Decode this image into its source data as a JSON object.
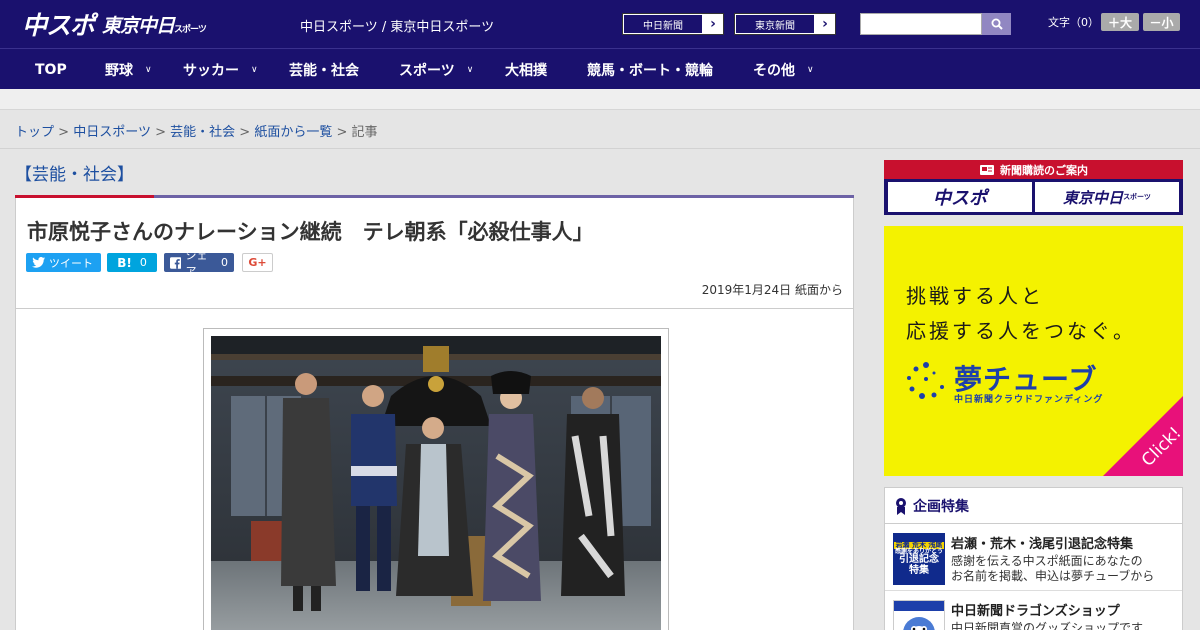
{
  "header": {
    "logo_main": "中スポ",
    "logo_sub": "東京中日",
    "logo_sub_small": "スポーツ",
    "site_title": "中日スポーツ / 東京中日スポーツ",
    "paper_links": [
      {
        "label": "中日新聞",
        "arrow": "›"
      },
      {
        "label": "東京新聞",
        "arrow": "›"
      }
    ],
    "search_placeholder": "",
    "font_size_label": "文字（0）",
    "font_larger": "＋大",
    "font_smaller": "－小"
  },
  "nav": {
    "items": [
      {
        "label": "TOP",
        "has_menu": false
      },
      {
        "label": "野球",
        "has_menu": true
      },
      {
        "label": "サッカー",
        "has_menu": true
      },
      {
        "label": "芸能・社会",
        "has_menu": false
      },
      {
        "label": "スポーツ",
        "has_menu": true
      },
      {
        "label": "大相撲",
        "has_menu": false
      },
      {
        "label": "競馬・ボート・競輪",
        "has_menu": false
      },
      {
        "label": "その他",
        "has_menu": true
      }
    ],
    "chevron": "∨"
  },
  "breadcrumb": {
    "items": [
      "トップ",
      "中日スポーツ",
      "芸能・社会",
      "紙面から一覧"
    ],
    "separator": ">",
    "current": "記事"
  },
  "section": {
    "title": "【芸能・社会】"
  },
  "article": {
    "headline": "市原悦子さんのナレーション継続　テレ朝系「必殺仕事人」",
    "share": {
      "tweet_label": "ツイート",
      "hatena_label": "B!",
      "hatena_count": "0",
      "facebook_label": "シェア",
      "facebook_count": "0",
      "gplus_label": "G+"
    },
    "date": "2019年1月24日 紙面から"
  },
  "sidebar": {
    "subscribe_header": "新聞購読のご案内",
    "subscribe_buttons": [
      "中スポ",
      "東京中日"
    ],
    "subscribe_small": "スポーツ",
    "ad": {
      "line1": "挑戦する人と",
      "line2": "応援する人をつなぐ。",
      "brand": "夢チューブ",
      "sub": "中日新聞クラウドファンディング",
      "click": "Click!"
    },
    "feature": {
      "heading": "企画特集",
      "items": [
        {
          "title": "岩瀬・荒木・浅尾引退記念特集",
          "desc1": "感謝を伝える中スポ紙面にあなたの",
          "desc2": "お名前を掲載、申込は夢チューブから",
          "thumb_text": [
            "岩瀬 荒木 浅尾",
            "感謝をありがとう",
            "引退記念",
            "特集"
          ]
        },
        {
          "title": "中日新聞ドラゴンズショップ",
          "desc1": "中日新聞直営のグッズショップです",
          "desc2": ""
        }
      ]
    }
  },
  "colors": {
    "navy": "#1a116e",
    "link_blue": "#1d4fa0",
    "accent_red": "#c8102e",
    "ad_yellow": "#f4f200",
    "ad_pink": "#e8117a"
  }
}
